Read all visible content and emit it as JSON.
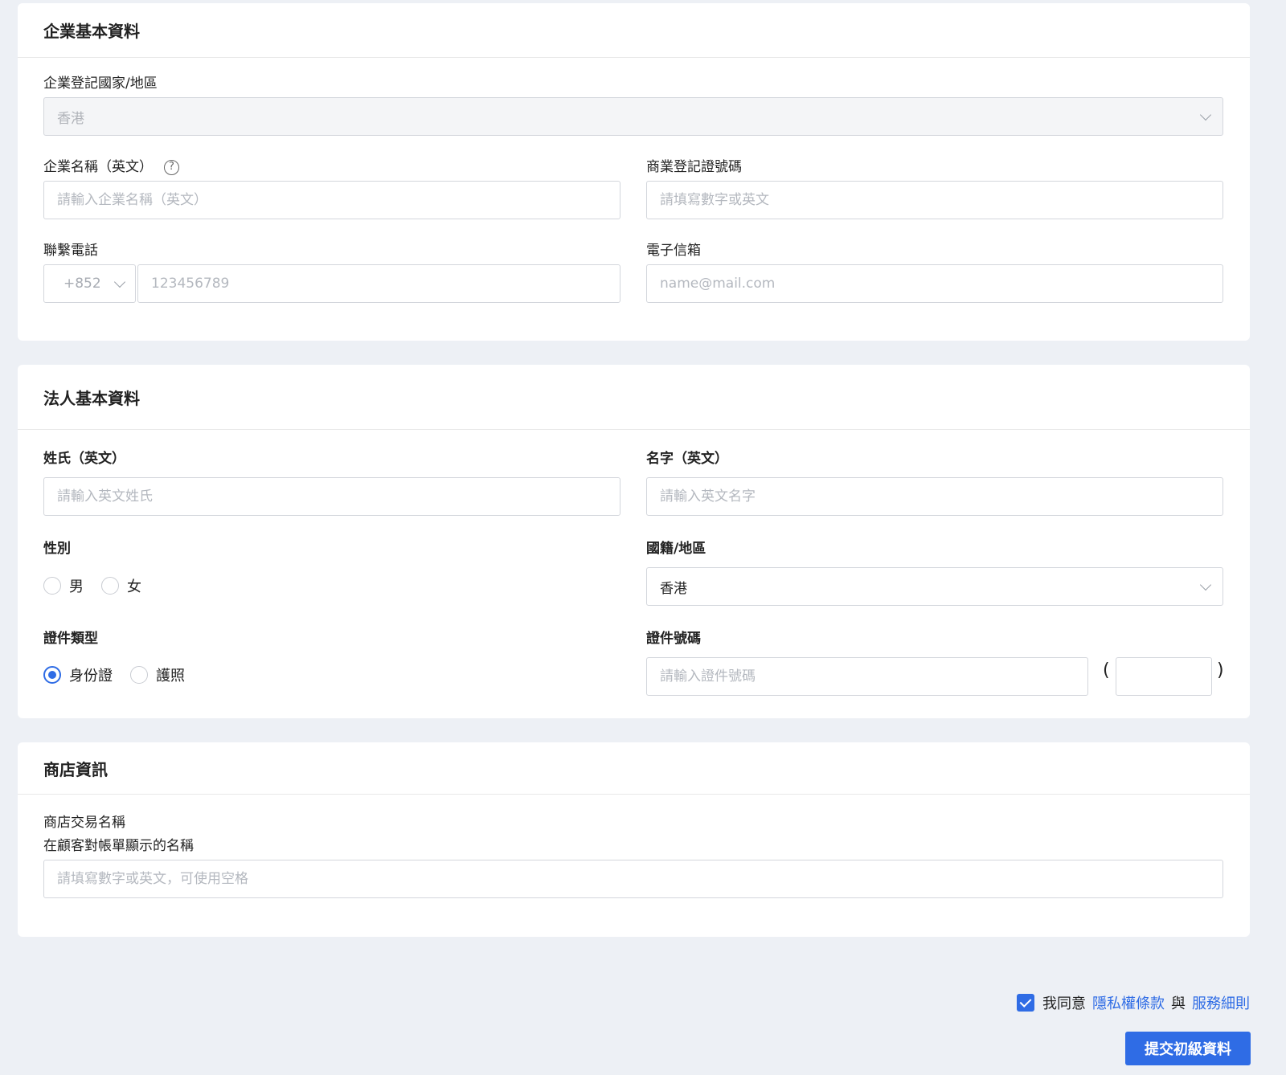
{
  "company": {
    "title": "企業基本資料",
    "country": {
      "label": "企業登記國家/地區",
      "value": "香港"
    },
    "name_en": {
      "label": "企業名稱（英文）",
      "help": "?",
      "placeholder": "請輸入企業名稱（英文）"
    },
    "br_number": {
      "label": "商業登記證號碼",
      "placeholder": "請填寫數字或英文"
    },
    "phone": {
      "label": "聯繫電話",
      "code": "+852",
      "placeholder": "123456789"
    },
    "email": {
      "label": "電子信箱",
      "placeholder": "name@mail.com"
    }
  },
  "legal": {
    "title": "法人基本資料",
    "surname": {
      "label": "姓氏（英文）",
      "placeholder": "請輸入英文姓氏"
    },
    "given_name": {
      "label": "名字（英文）",
      "placeholder": "請輸入英文名字"
    },
    "gender": {
      "label": "性別",
      "options": [
        "男",
        "女"
      ]
    },
    "nationality": {
      "label": "國籍/地區",
      "value": "香港"
    },
    "id_type": {
      "label": "證件類型",
      "options": [
        "身份證",
        "護照"
      ],
      "selected": "身份證"
    },
    "id_number": {
      "label": "證件號碼",
      "placeholder": "請輸入證件號碼",
      "open_paren": "(",
      "close_paren": ")"
    }
  },
  "store": {
    "title": "商店資訊",
    "trade_name": {
      "label": "商店交易名稱",
      "sublabel": "在顧客對帳單顯示的名稱",
      "placeholder": "請填寫數字或英文，可使用空格"
    }
  },
  "footer": {
    "agree_text": "我同意",
    "privacy_link": "隱私權條款",
    "and_text": "與",
    "terms_link": "服務細則",
    "submit_label": "提交初級資料"
  },
  "colors": {
    "accent": "#2f6ce5",
    "background": "#edf0f5"
  }
}
